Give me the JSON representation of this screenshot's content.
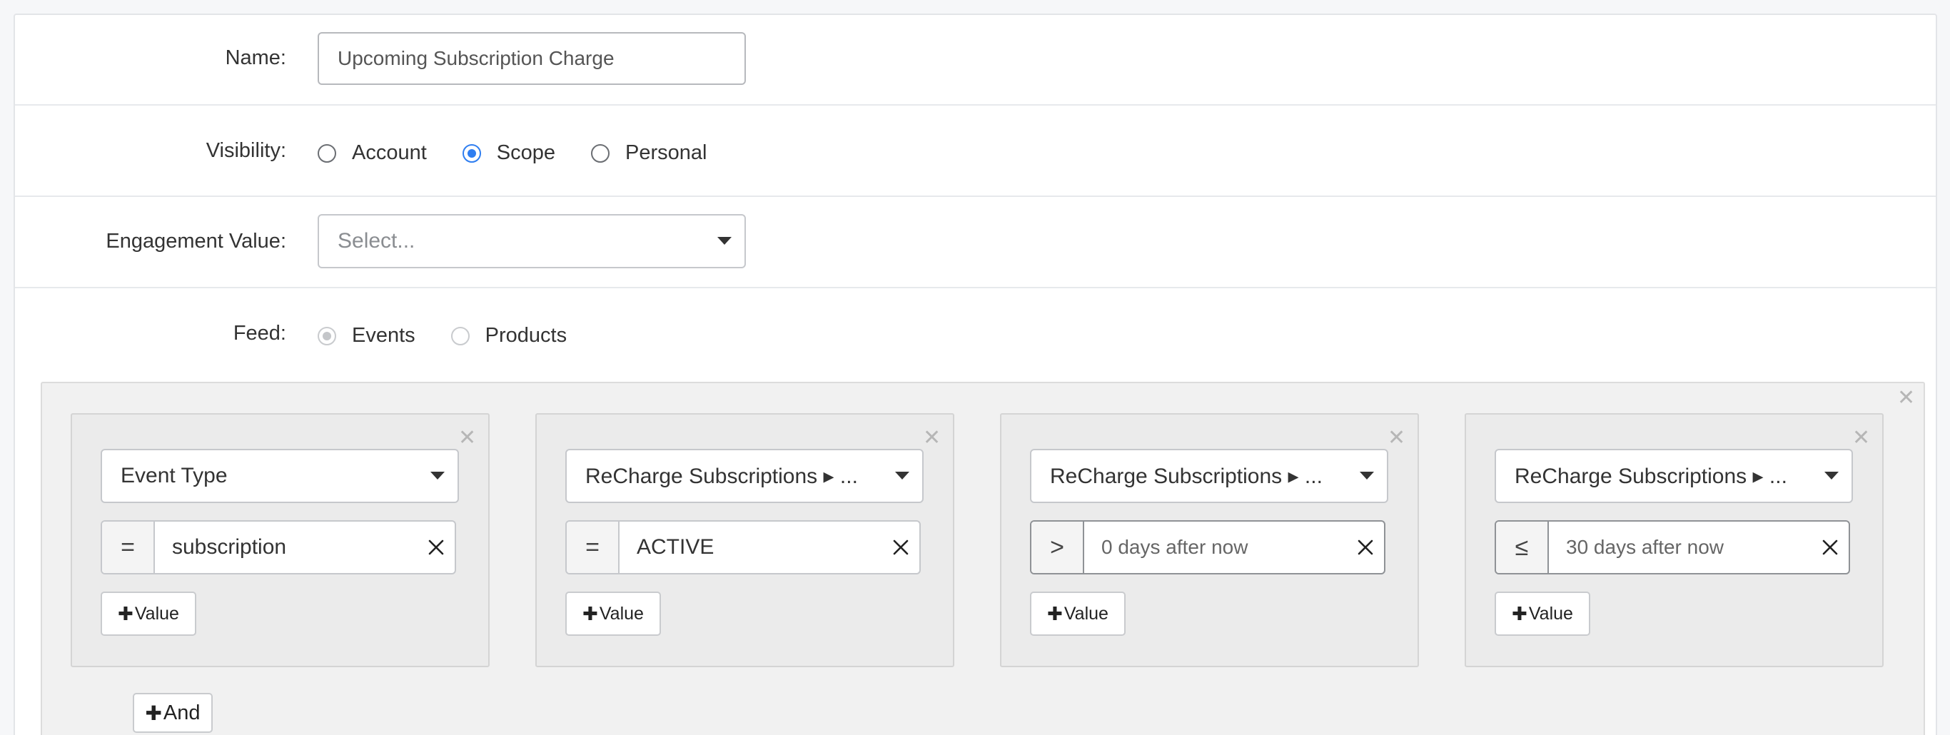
{
  "form": {
    "name": {
      "label": "Name:",
      "value": "Upcoming Subscription Charge"
    },
    "visibility": {
      "label": "Visibility:",
      "options": [
        {
          "label": "Account",
          "checked": false
        },
        {
          "label": "Scope",
          "checked": true
        },
        {
          "label": "Personal",
          "checked": false
        }
      ]
    },
    "engagement": {
      "label": "Engagement Value:",
      "placeholder": "Select..."
    },
    "feed": {
      "label": "Feed:",
      "options": [
        {
          "label": "Events",
          "checked": true,
          "disabled": true
        },
        {
          "label": "Products",
          "checked": false,
          "disabled": true
        }
      ]
    }
  },
  "filters": {
    "cards": [
      {
        "field": "Event Type",
        "operator": "=",
        "value": "subscription",
        "add_value_label": "Value"
      },
      {
        "field": "ReCharge Subscriptions ▸ ...",
        "operator": "=",
        "value": "ACTIVE",
        "add_value_label": "Value"
      },
      {
        "field": "ReCharge Subscriptions ▸ ...",
        "operator": ">",
        "value": "0 days after now",
        "add_value_label": "Value"
      },
      {
        "field": "ReCharge Subscriptions ▸ ...",
        "operator": "≤",
        "value": "30 days after now",
        "add_value_label": "Value"
      }
    ],
    "and_label": "And"
  },
  "icons": {
    "close": "close-icon",
    "clear": "clear-icon",
    "caret": "chevron-down-icon",
    "plus": "plus-icon"
  },
  "colors": {
    "radio_accent": "#2f7ef0",
    "panel_bg": "#f1f1f1",
    "card_bg": "#ebebeb"
  }
}
